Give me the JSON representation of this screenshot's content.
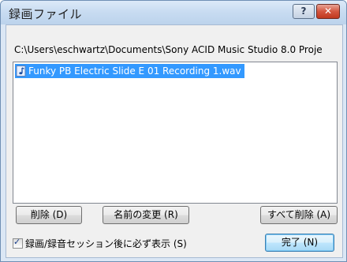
{
  "window": {
    "title": "録画ファイル",
    "help_label": "?",
    "close_label": "✕"
  },
  "path": "C:\\Users\\eschwartz\\Documents\\Sony ACID Music Studio 8.0 Proje",
  "files": [
    {
      "name": "Funky PB Electric Slide E 01 Recording 1.wav",
      "icon": "audio-file-icon",
      "selected": true
    }
  ],
  "buttons": {
    "delete": "削除 (D)",
    "rename": "名前の変更 (R)",
    "delete_all": "すべて削除 (A)",
    "done": "完了 (N)"
  },
  "checkbox": {
    "label": "録画/録音セッション後に必ず表示 (S)",
    "checked": true
  }
}
